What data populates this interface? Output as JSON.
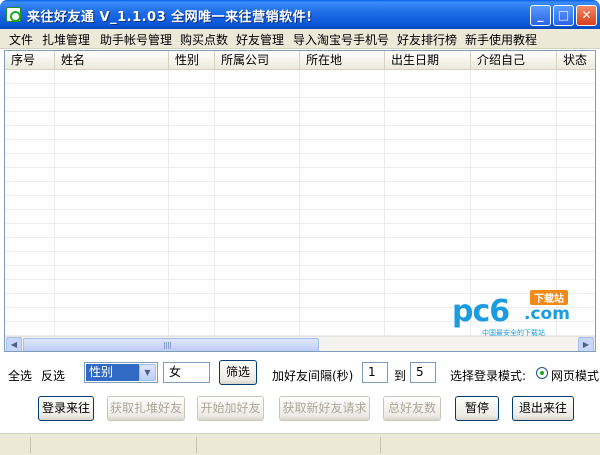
{
  "window": {
    "title": "来往好友通 V_1.1.03  全网唯一来往营销软件!",
    "minimize_glyph": "_",
    "maximize_glyph": "□",
    "close_glyph": "✕"
  },
  "menu": [
    "文件",
    "扎堆管理",
    "助手帐号管理",
    "购买点数",
    "好友管理",
    "导入淘宝号手机号",
    "好友排行榜",
    "新手使用教程"
  ],
  "table": {
    "columns": [
      "序号",
      "姓名",
      "性别",
      "所属公司",
      "所在地",
      "出生日期",
      "介绍自己",
      "状态"
    ],
    "rows": []
  },
  "scrollbar": {
    "left_glyph": "◀",
    "right_glyph": "▶"
  },
  "logo": {
    "brand": "pc6",
    "suffix": ".com",
    "tag": "下载站",
    "slogan": "中国最安全的下载站"
  },
  "controls": {
    "select_all": "全选",
    "invert": "反选",
    "filter_field": {
      "selected": "性别",
      "arrow": "▼"
    },
    "filter_value": "女",
    "filter_button": "筛选",
    "interval_label": "加好友间隔(秒)",
    "interval_from": "1",
    "interval_to_label": "到",
    "interval_to": "5",
    "login_mode_label": "选择登录模式:",
    "login_mode_option": "网页模式"
  },
  "buttons": {
    "login": "登录来往",
    "get_groups": "获取扎堆好友",
    "start_add": "开始加好友",
    "get_requests": "获取新好友请求",
    "total": "总好友数",
    "pause": "暂停",
    "exit": "退出来往"
  },
  "colors": {
    "titlebar": "#0a56d8",
    "selection": "#316ac5",
    "brand": "#1b9be0"
  }
}
